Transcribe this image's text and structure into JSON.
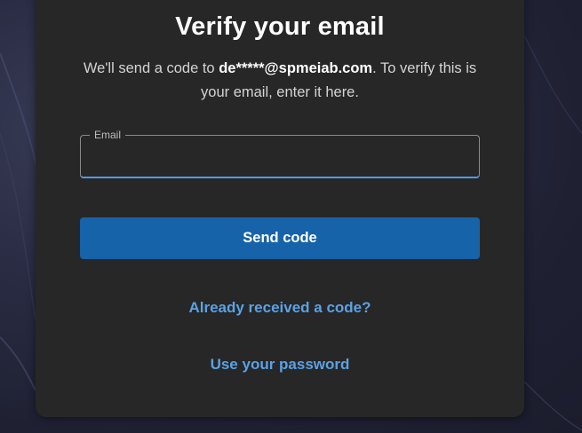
{
  "dialog": {
    "title": "Verify your email",
    "description_prefix": "We'll send a code to ",
    "masked_email": "de*****@spmeiab.com",
    "description_suffix": ". To verify this is your email, enter it here."
  },
  "email_field": {
    "label": "Email",
    "value": ""
  },
  "send_button": {
    "label": "Send code"
  },
  "links": {
    "already_received": "Already received a code?",
    "use_password": "Use your password"
  },
  "colors": {
    "card_background": "#272727",
    "primary_button": "#1663a9",
    "link": "#5aa2e6",
    "focus_underline": "#4f9be8"
  }
}
